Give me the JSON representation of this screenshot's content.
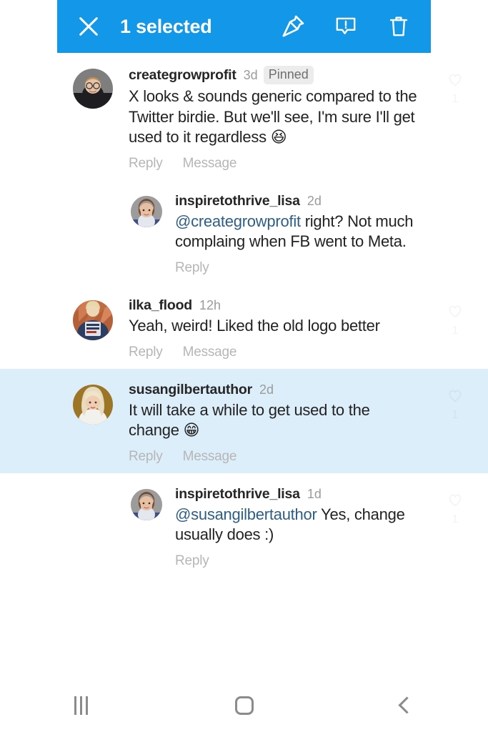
{
  "header": {
    "title": "1 selected",
    "close_icon": "close-icon",
    "pin_icon": "pin-icon",
    "report_icon": "report-exclamation-icon",
    "delete_icon": "trash-icon",
    "background_color": "#1397e8",
    "text_color": "#ffffff"
  },
  "selection_highlight_color": "#ddeefb",
  "mention_color": "#2d5e86",
  "comments": [
    {
      "username": "creategrowprofit",
      "timeago": "3d",
      "pinned_label": "Pinned",
      "text_before_mention": "",
      "mention": "",
      "text": "X looks & sounds generic compared to the Twitter birdie. But we'll see, I'm sure I'll get used to it regardless ",
      "emoji": "😆",
      "level": "top",
      "selected": false,
      "like_count": "1",
      "actions": [
        "Reply",
        "Message"
      ]
    },
    {
      "username": "inspiretothrive_lisa",
      "timeago": "2d",
      "pinned_label": "",
      "mention": "@creategrowprofit",
      "text": " right? Not much complaing when FB went to Meta.",
      "emoji": "",
      "level": "reply",
      "selected": false,
      "like_count": "",
      "actions": [
        "Reply"
      ]
    },
    {
      "username": "ilka_flood",
      "timeago": "12h",
      "pinned_label": "",
      "mention": "",
      "text": "Yeah, weird! Liked the old logo better",
      "emoji": "",
      "level": "top",
      "selected": false,
      "like_count": "1",
      "actions": [
        "Reply",
        "Message"
      ]
    },
    {
      "username": "susangilbertauthor",
      "timeago": "2d",
      "pinned_label": "",
      "mention": "",
      "text": "It will take a while to get used to the change ",
      "emoji": "😁",
      "level": "top",
      "selected": true,
      "like_count": "1",
      "actions": [
        "Reply",
        "Message"
      ]
    },
    {
      "username": "inspiretothrive_lisa",
      "timeago": "1d",
      "pinned_label": "",
      "mention": "@susangilbertauthor",
      "text": " Yes, change usually does :)",
      "emoji": "",
      "level": "reply",
      "selected": false,
      "like_count": "1",
      "actions": [
        "Reply"
      ]
    }
  ],
  "navbar": {
    "recents_label": "recent-apps",
    "home_label": "home",
    "back_label": "back"
  }
}
